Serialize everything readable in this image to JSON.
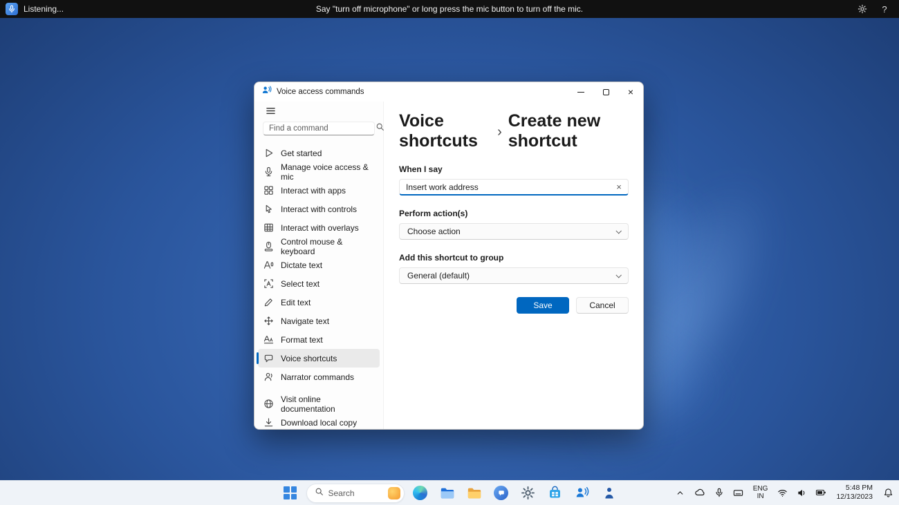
{
  "voice_bar": {
    "status": "Listening...",
    "message": "Say \"turn off microphone\" or long press the mic button to turn off the mic."
  },
  "window": {
    "title": "Voice access commands",
    "sidebar": {
      "search_placeholder": "Find a command",
      "items": [
        {
          "label": "Get started",
          "icon": "play-icon"
        },
        {
          "label": "Manage voice access & mic",
          "icon": "mic-icon"
        },
        {
          "label": "Interact with apps",
          "icon": "apps-grid-icon"
        },
        {
          "label": "Interact with controls",
          "icon": "cursor-icon"
        },
        {
          "label": "Interact with overlays",
          "icon": "overlay-grid-icon"
        },
        {
          "label": "Control mouse & keyboard",
          "icon": "mouse-keyboard-icon"
        },
        {
          "label": "Dictate text",
          "icon": "dictate-text-icon"
        },
        {
          "label": "Select text",
          "icon": "select-text-icon"
        },
        {
          "label": "Edit text",
          "icon": "edit-text-icon"
        },
        {
          "label": "Navigate text",
          "icon": "navigate-text-icon"
        },
        {
          "label": "Format text",
          "icon": "format-text-icon"
        },
        {
          "label": "Voice shortcuts",
          "icon": "voice-shortcuts-icon",
          "selected": true
        },
        {
          "label": "Narrator commands",
          "icon": "narrator-icon"
        }
      ],
      "footer_items": [
        {
          "label": "Visit online documentation",
          "icon": "globe-icon"
        },
        {
          "label": "Download local copy",
          "icon": "download-icon"
        }
      ]
    },
    "main": {
      "breadcrumb": {
        "parent": "Voice shortcuts",
        "current": "Create new shortcut"
      },
      "when_i_say": {
        "label": "When I say",
        "value": "Insert work address"
      },
      "perform_actions": {
        "label": "Perform action(s)",
        "value": "Choose action"
      },
      "group": {
        "label": "Add this shortcut to group",
        "value": "General (default)"
      },
      "buttons": {
        "save": "Save",
        "cancel": "Cancel"
      }
    }
  },
  "taskbar": {
    "search_placeholder": "Search",
    "app_icons": [
      "start-icon",
      "search-highlights-icon",
      "edge-icon",
      "file-explorer-icon",
      "folder-icon",
      "chat-icon",
      "settings-icon",
      "store-icon",
      "voice-access-icon",
      "accessibility-icon"
    ],
    "tray": {
      "language": {
        "line1": "ENG",
        "line2": "IN"
      },
      "time": "5:48 PM",
      "date": "12/13/2023"
    }
  },
  "colors": {
    "accent": "#0067c0",
    "voice_bar_bg": "#111111",
    "taskbar_bg": "#eff3f8",
    "wallpaper_deep": "#16305f",
    "wallpaper_mid": "#2b5ea9",
    "wallpaper_light": "#7fb2f0"
  }
}
